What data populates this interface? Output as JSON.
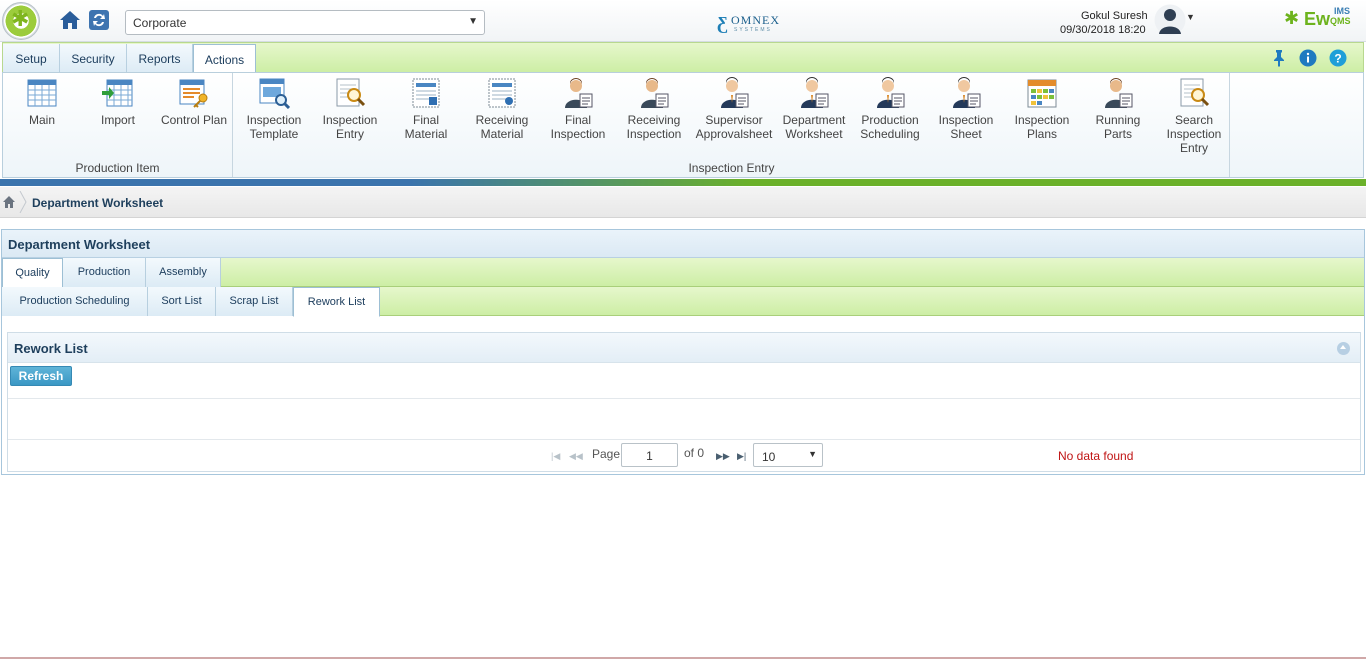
{
  "header": {
    "company": "Corporate",
    "omnex_logo_text": "OMNEX",
    "omnex_logo_sub": "SYSTEMS",
    "user_name": "Gokul Suresh",
    "user_datetime": "09/30/2018 18:20",
    "app_logo_main": "Ew",
    "app_logo_top": "IMS",
    "app_logo_bottom": "QMS"
  },
  "ribbon": {
    "tabs": [
      "Setup",
      "Security",
      "Reports",
      "Actions"
    ],
    "active_tab": "Actions",
    "groups": [
      {
        "label": "Production Item",
        "items": [
          "Main",
          "Import",
          "Control Plan"
        ]
      },
      {
        "label": "Inspection Entry",
        "items": [
          "Inspection Template",
          "Inspection Entry",
          "Final Material",
          "Receiving Material",
          "Final Inspection",
          "Receiving Inspection",
          "Supervisor Approvalsheet",
          "Department Worksheet",
          "Production Scheduling",
          "Inspection Sheet",
          "Inspection Plans",
          "Running Parts",
          "Search Inspection Entry"
        ]
      }
    ],
    "item_lines": {
      "main": [
        "Main"
      ],
      "import": [
        "Import"
      ],
      "control_plan": [
        "Control Plan"
      ],
      "inspection_template": [
        "Inspection",
        "Template"
      ],
      "inspection_entry": [
        "Inspection",
        "Entry"
      ],
      "final_material": [
        "Final",
        "Material"
      ],
      "receiving_material": [
        "Receiving",
        "Material"
      ],
      "final_inspection": [
        "Final",
        "Inspection"
      ],
      "receiving_inspection": [
        "Receiving",
        "Inspection"
      ],
      "supervisor_approvalsheet": [
        "Supervisor",
        "Approvalsheet"
      ],
      "department_worksheet": [
        "Department",
        "Worksheet"
      ],
      "production_scheduling": [
        "Production",
        "Scheduling"
      ],
      "inspection_sheet": [
        "Inspection",
        "Sheet"
      ],
      "inspection_plans": [
        "Inspection",
        "Plans"
      ],
      "running_parts": [
        "Running",
        "Parts"
      ],
      "search_inspection_entry": [
        "Search",
        "Inspection",
        "Entry"
      ]
    }
  },
  "breadcrumb": {
    "current": "Department Worksheet"
  },
  "page": {
    "title": "Department Worksheet",
    "tabs": [
      "Quality",
      "Production",
      "Assembly"
    ],
    "active_tab": "Quality",
    "subtabs": [
      "Production Scheduling",
      "Sort List",
      "Scrap List",
      "Rework List"
    ],
    "active_subtab": "Rework List",
    "panel_title": "Rework List",
    "refresh_label": "Refresh",
    "pager": {
      "page_label": "Page",
      "page_value": "1",
      "of_label": "of 0",
      "page_size": "10",
      "empty_message": "No data found"
    }
  },
  "colors": {
    "accent_green": "#6db31d",
    "accent_blue": "#3b74ad",
    "error_red": "#c01515"
  }
}
